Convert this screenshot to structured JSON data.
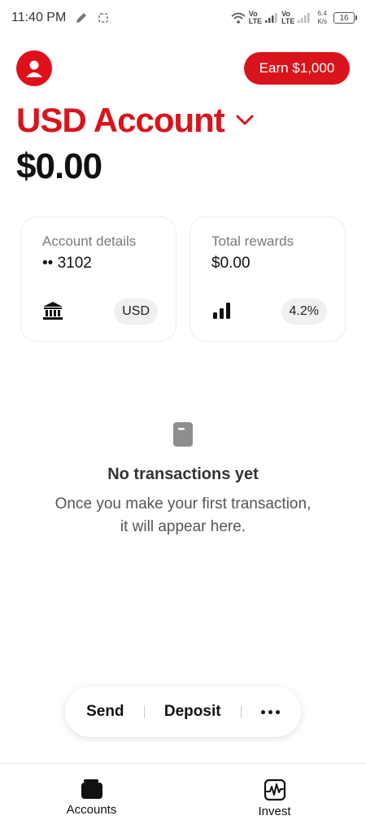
{
  "status_bar": {
    "time": "11:40 PM",
    "lte1": [
      "Vo",
      "LTE"
    ],
    "lte2": [
      "Vo",
      "LTE"
    ],
    "speed_value": "6.4",
    "speed_unit": "K/s",
    "battery": "16"
  },
  "header": {
    "earn_button": "Earn $1,000",
    "account_title": "USD Account",
    "balance": "$0.00"
  },
  "cards": {
    "account_details": {
      "title": "Account details",
      "value": "•• 3102",
      "badge": "USD",
      "icon": "bank-icon"
    },
    "total_rewards": {
      "title": "Total rewards",
      "value": "$0.00",
      "badge": "4.2%",
      "icon": "bar-chart-icon"
    }
  },
  "empty_state": {
    "icon": "receipt-icon",
    "title": "No transactions yet",
    "line1": "Once you make your first transaction,",
    "line2": "it will appear here."
  },
  "actions": {
    "send": "Send",
    "deposit": "Deposit",
    "more_icon": "more-icon"
  },
  "bottom_nav": {
    "accounts": "Accounts",
    "invest": "Invest"
  },
  "colors": {
    "brand_red": "#d9141c",
    "muted_text": "#7a7a7a"
  }
}
